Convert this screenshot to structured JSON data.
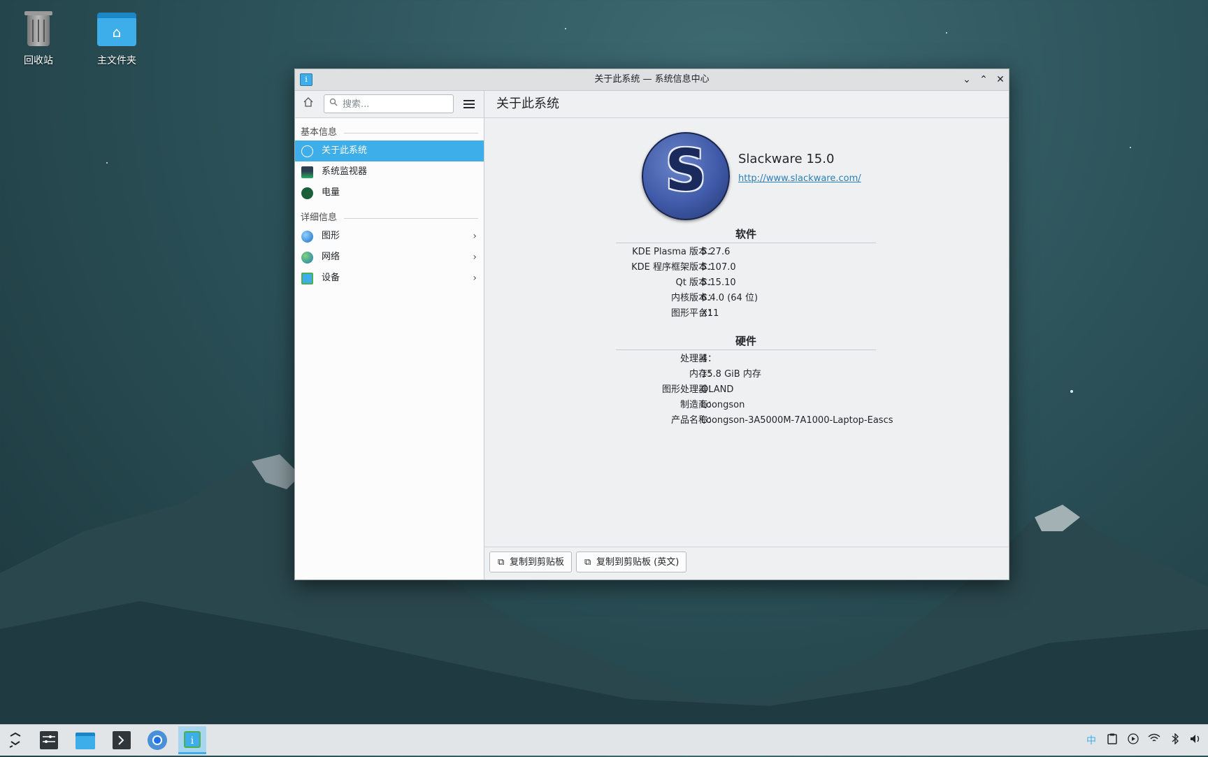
{
  "desktop": {
    "icons": [
      {
        "label": "回收站",
        "icon": "trash-icon"
      },
      {
        "label": "主文件夹",
        "icon": "home-folder-icon"
      }
    ]
  },
  "window": {
    "title": "关于此系统 — 系统信息中心",
    "controls": {
      "minimize": "⌄",
      "maximize": "⌃",
      "close": "✕"
    }
  },
  "sidebar": {
    "search_placeholder": "搜索...",
    "sections": [
      {
        "title": "基本信息",
        "items": [
          {
            "label": "关于此系统",
            "icon": "info-icon",
            "active": true
          },
          {
            "label": "系统监视器",
            "icon": "system-monitor-icon"
          },
          {
            "label": "电量",
            "icon": "energy-icon"
          }
        ]
      },
      {
        "title": "详细信息",
        "items": [
          {
            "label": "图形",
            "icon": "graphics-icon",
            "has_children": true
          },
          {
            "label": "网络",
            "icon": "network-icon",
            "has_children": true
          },
          {
            "label": "设备",
            "icon": "devices-icon",
            "has_children": true
          }
        ]
      }
    ]
  },
  "main": {
    "title": "关于此系统",
    "os_name": "Slackware 15.0",
    "os_url": "http://www.slackware.com/",
    "logo_letter": "S",
    "software": {
      "title": "软件",
      "rows": [
        {
          "key": "KDE Plasma 版本：",
          "value": "5.27.6"
        },
        {
          "key": "KDE 程序框架版本：",
          "value": "5.107.0"
        },
        {
          "key": "Qt 版本：",
          "value": "5.15.10"
        },
        {
          "key": "内核版本：",
          "value": "6.4.0 (64 位)"
        },
        {
          "key": "图形平台：",
          "value": "X11"
        }
      ]
    },
    "hardware": {
      "title": "硬件",
      "rows": [
        {
          "key": "处理器：",
          "value": "4"
        },
        {
          "key": "内存：",
          "value": "15.8 GiB 内存"
        },
        {
          "key": "图形处理器：",
          "value": "OLAND"
        },
        {
          "key": "制造商：",
          "value": "Loongson"
        },
        {
          "key": "产品名称：",
          "value": "Loongson-3A5000M-7A1000-Laptop-Eascs"
        }
      ]
    },
    "buttons": {
      "copy": "复制到剪贴板",
      "copy_en": "复制到剪贴板 (英文)"
    }
  },
  "taskbar": {
    "apps": [
      "app-launcher-icon",
      "system-settings-icon",
      "file-manager-icon",
      "terminal-icon",
      "chromium-icon",
      "info-center-icon"
    ],
    "tray": {
      "input_method": "中",
      "icons": [
        "clipboard-icon",
        "media-player-icon",
        "wifi-icon",
        "bluetooth-icon",
        "volume-icon"
      ]
    }
  }
}
